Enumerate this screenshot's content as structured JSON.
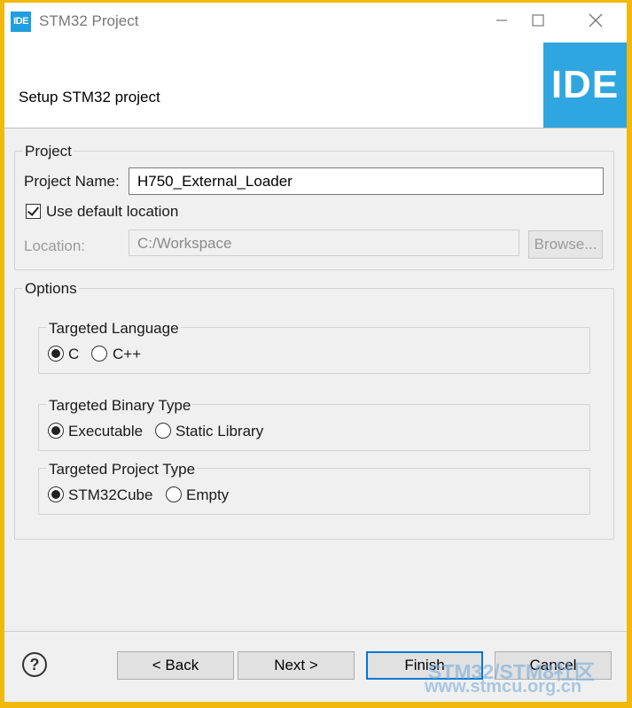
{
  "window": {
    "title": "STM32 Project",
    "icon_text": "IDE"
  },
  "header": {
    "title": "Setup STM32 project",
    "logo_text": "IDE"
  },
  "project": {
    "group_label": "Project",
    "name_label": "Project Name:",
    "name_value": "H750_External_Loader",
    "use_default_label": "Use default location",
    "use_default_checked": true,
    "location_label": "Location:",
    "location_value": "C:/Workspace",
    "browse_label": "Browse..."
  },
  "options": {
    "group_label": "Options",
    "language": {
      "label": "Targeted Language",
      "options": [
        "C",
        "C++"
      ],
      "selected": "C"
    },
    "binary": {
      "label": "Targeted Binary Type",
      "options": [
        "Executable",
        "Static Library"
      ],
      "selected": "Executable"
    },
    "project_type": {
      "label": "Targeted Project Type",
      "options": [
        "STM32Cube",
        "Empty"
      ],
      "selected": "STM32Cube"
    }
  },
  "footer": {
    "help": "?",
    "back_label": "< Back",
    "next_label": "Next >",
    "finish_label": "Finish",
    "cancel_label": "Cancel"
  },
  "watermark": {
    "line1": "STM32/STM8社区",
    "line2": "www.stmcu.org.cn"
  },
  "colors": {
    "accent": "#0078d7",
    "logo_blue": "#2fa6e0",
    "frame": "#f0b90b"
  }
}
